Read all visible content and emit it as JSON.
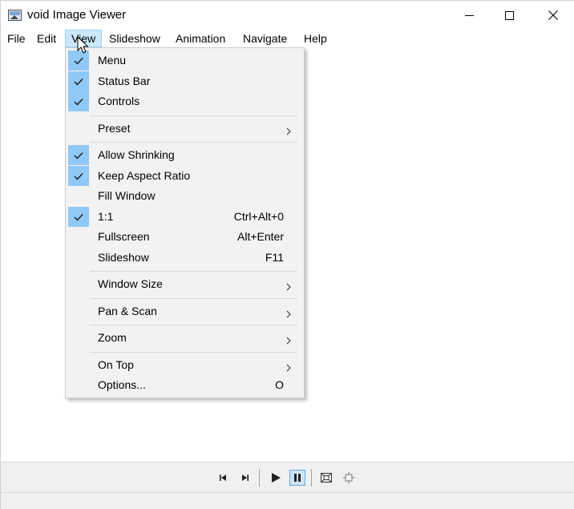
{
  "window": {
    "title": "void Image Viewer"
  },
  "menubar": {
    "items": [
      {
        "label": "File"
      },
      {
        "label": "Edit"
      },
      {
        "label": "View"
      },
      {
        "label": "Slideshow"
      },
      {
        "label": "Animation"
      },
      {
        "label": "Navigate"
      },
      {
        "label": "Help"
      }
    ],
    "active": "View"
  },
  "view_menu": {
    "items": [
      {
        "label": "Menu",
        "checked": true,
        "shortcut": "",
        "submenu": false
      },
      {
        "label": "Status Bar",
        "checked": true,
        "shortcut": "",
        "submenu": false
      },
      {
        "label": "Controls",
        "checked": true,
        "shortcut": "",
        "submenu": false
      },
      {
        "label": "Preset",
        "checked": false,
        "shortcut": "",
        "submenu": true
      },
      {
        "label": "Allow Shrinking",
        "checked": true,
        "shortcut": "",
        "submenu": false
      },
      {
        "label": "Keep Aspect Ratio",
        "checked": true,
        "shortcut": "",
        "submenu": false
      },
      {
        "label": "Fill Window",
        "checked": false,
        "shortcut": "",
        "submenu": false
      },
      {
        "label": "1:1",
        "checked": true,
        "shortcut": "Ctrl+Alt+0",
        "submenu": false
      },
      {
        "label": "Fullscreen",
        "checked": false,
        "shortcut": "Alt+Enter",
        "submenu": false
      },
      {
        "label": "Slideshow",
        "checked": false,
        "shortcut": "F11",
        "submenu": false
      },
      {
        "label": "Window Size",
        "checked": false,
        "shortcut": "",
        "submenu": true
      },
      {
        "label": "Pan & Scan",
        "checked": false,
        "shortcut": "",
        "submenu": true
      },
      {
        "label": "Zoom",
        "checked": false,
        "shortcut": "",
        "submenu": true
      },
      {
        "label": "On Top",
        "checked": false,
        "shortcut": "",
        "submenu": true
      },
      {
        "label": "Options...",
        "checked": false,
        "shortcut": "O",
        "submenu": false
      }
    ]
  },
  "controls": {
    "buttons": [
      {
        "icon": "skip-previous-icon",
        "pressed": false
      },
      {
        "icon": "skip-next-icon",
        "pressed": false
      },
      {
        "icon": "play-icon",
        "pressed": false
      },
      {
        "icon": "pause-icon",
        "pressed": true
      },
      {
        "icon": "fit-window-icon",
        "pressed": false
      },
      {
        "icon": "actual-size-icon",
        "pressed": false
      }
    ]
  },
  "colors": {
    "menu_highlight": "#cce8ff",
    "check_background": "#90c8f6",
    "menu_background": "#f2f2f2",
    "pressed_button": "#cce4f7"
  }
}
